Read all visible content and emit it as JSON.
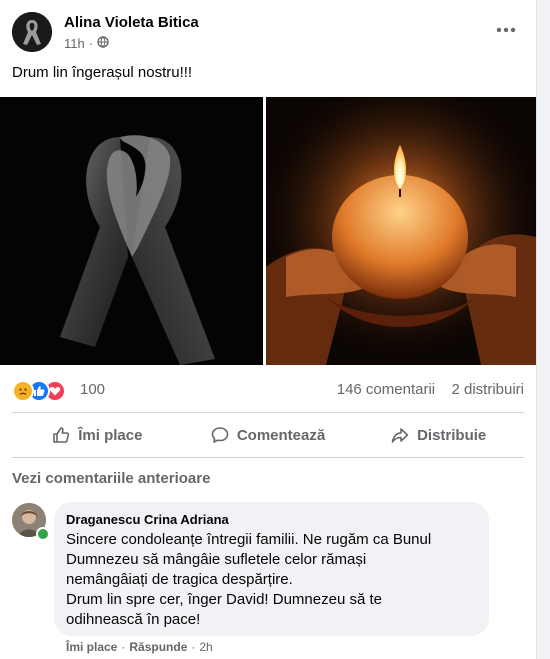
{
  "post": {
    "author": "Alina Violeta Bitica",
    "time": "11h",
    "separator": "·",
    "privacy_icon": "globe-icon",
    "text": "Drum lin îngerașul nostru!!!"
  },
  "reactions": {
    "icons": [
      "sad-icon",
      "like-icon",
      "love-icon"
    ],
    "count": "100",
    "comments": "146 comentarii",
    "shares": "2 distribuiri"
  },
  "actions": {
    "like": "Îmi place",
    "comment": "Comentează",
    "share": "Distribuie"
  },
  "comments": {
    "view_previous": "Vezi comentariile anterioare",
    "items": [
      {
        "name": "Draganescu Crina Adriana",
        "lines": [
          "Sincere condoleanțe întregii familii. Ne rugăm ca Bunul",
          "Dumnezeu să mângâie sufletele celor rămași",
          "nemângâiați de tragica despărțire.",
          "Drum lin spre cer, înger David! Dumnezeu să te",
          "odihnească în pace!"
        ],
        "like": "Îmi place",
        "reply": "Răspunde",
        "dot": "·",
        "time": "2h"
      }
    ]
  },
  "colors": {
    "secondary_text": "#65676b",
    "like_blue": "#1877f2",
    "love_red": "#f33e58",
    "sad_yellow": "#f7b125",
    "online_green": "#31a24c"
  }
}
